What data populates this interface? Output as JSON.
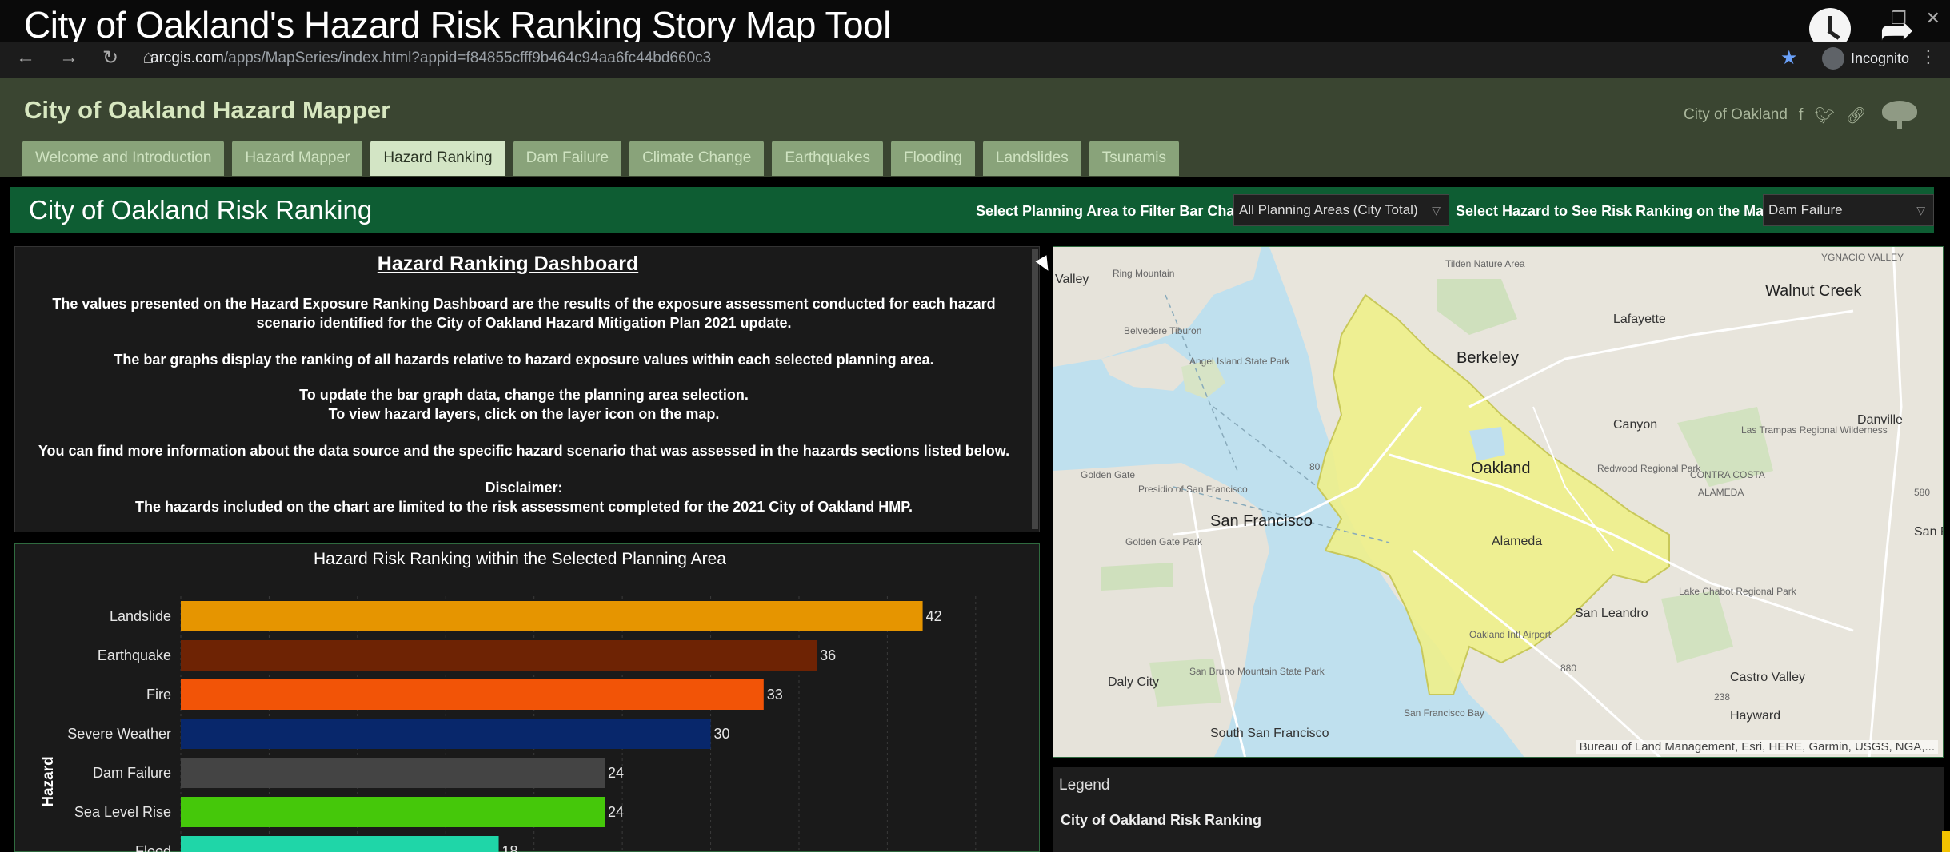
{
  "video_title": "City of Oakland's Hazard Risk Ranking Story Map Tool",
  "browser": {
    "url_host": "arcgis.com",
    "url_path": "/apps/MapSeries/index.html?appid=f84855cfff9b464c94aa6fc44bd660c3",
    "profile": "Incognito"
  },
  "app": {
    "title": "City of Oakland Hazard Mapper",
    "org_link": "City of Oakland",
    "tabs": [
      {
        "label": "Welcome and Introduction",
        "active": false
      },
      {
        "label": "Hazard Mapper",
        "active": false
      },
      {
        "label": "Hazard Ranking",
        "active": true
      },
      {
        "label": "Dam Failure",
        "active": false
      },
      {
        "label": "Climate Change",
        "active": false
      },
      {
        "label": "Earthquakes",
        "active": false
      },
      {
        "label": "Flooding",
        "active": false
      },
      {
        "label": "Landslides",
        "active": false
      },
      {
        "label": "Tsunamis",
        "active": false
      }
    ]
  },
  "ranking": {
    "title": "City of Oakland Risk Ranking",
    "filter_label": "Select Planning Area to Filter Bar Chart",
    "filter_value": "All Planning Areas (City Total)",
    "hazard_label": "Select Hazard to See Risk Ranking on the Map",
    "hazard_value": "Dam Failure"
  },
  "dashboard": {
    "title": "Hazard Ranking Dashboard ",
    "p1": "The values presented on the Hazard Exposure Ranking Dashboard are the results of the exposure assessment conducted for each hazard scenario identified for the City of Oakland Hazard Mitigation Plan 2021 update.",
    "p2": "The bar graphs display the ranking of all hazards relative to hazard exposure values within each selected planning area.",
    "p3a": "To update the bar graph data, change the planning area selection.",
    "p3b": "To view hazard layers, click on the layer icon on the map.",
    "p4": "You can find more information about the data source and the specific hazard scenario that was assessed in the hazards sections listed below.",
    "disclaimer_label": "Disclaimer:",
    "disclaimer": "The hazards included on the chart are limited to the risk assessment completed for the 2021 City of Oakland HMP."
  },
  "chart_data": {
    "type": "bar",
    "orientation": "horizontal",
    "title": "Hazard Risk Ranking within the Selected Planning Area",
    "ylabel": "Hazard",
    "xlim": [
      0,
      47
    ],
    "grid": true,
    "categories": [
      "Landslide",
      "Earthquake",
      "Fire",
      "Severe Weather",
      "Dam Failure",
      "Sea Level Rise",
      "Flood"
    ],
    "values": [
      42,
      36,
      33,
      30,
      24,
      24,
      18
    ],
    "colors": [
      "#e69500",
      "#6e2304",
      "#f25407",
      "#08276b",
      "#444444",
      "#45c80a",
      "#1fd6a8"
    ]
  },
  "map": {
    "labels": {
      "ring_mountain": "Ring Mountain",
      "valley": "Valley",
      "tilden": "Tilden Nature Area",
      "ygnacio": "YGNACIO VALLEY",
      "walnut_creek": "Walnut Creek",
      "lafayette": "Lafayette",
      "belvedere": "Belvedere Tiburon",
      "angel_island": "Angel Island State Park",
      "berkeley": "Berkeley",
      "canyon": "Canyon",
      "danville": "Danville",
      "las_trampas": "Las Trampas Regional Wilderness",
      "oakland": "Oakland",
      "golden_gate": "Golden Gate",
      "presidio": "Presidio of San Francisco",
      "redwood": "Redwood Regional Park",
      "contra_costa": "CONTRA COSTA",
      "alameda_county": "ALAMEDA",
      "san_francisco": "San Francisco",
      "ggpark": "Golden Gate Park",
      "alameda": "Alameda",
      "san_r": "San R",
      "lake_chabot": "Lake Chabot Regional Park",
      "san_leandro": "San Leandro",
      "oakland_airport": "Oakland Intl Airport",
      "daly_city": "Daly City",
      "san_bruno": "San Bruno Mountain State Park",
      "castro_valley": "Castro Valley",
      "hayward": "Hayward",
      "south_sf": "South San Francisco",
      "sf_bay": "San Francisco Bay",
      "hwy80": "80",
      "hwy580": "580",
      "hwy880": "880",
      "hwy238": "238"
    },
    "attribution": "Bureau of Land Management, Esri, HERE, Garmin, USGS, NGA,..."
  },
  "legend": {
    "title": "Legend",
    "layer": "City of Oakland Risk Ranking"
  }
}
